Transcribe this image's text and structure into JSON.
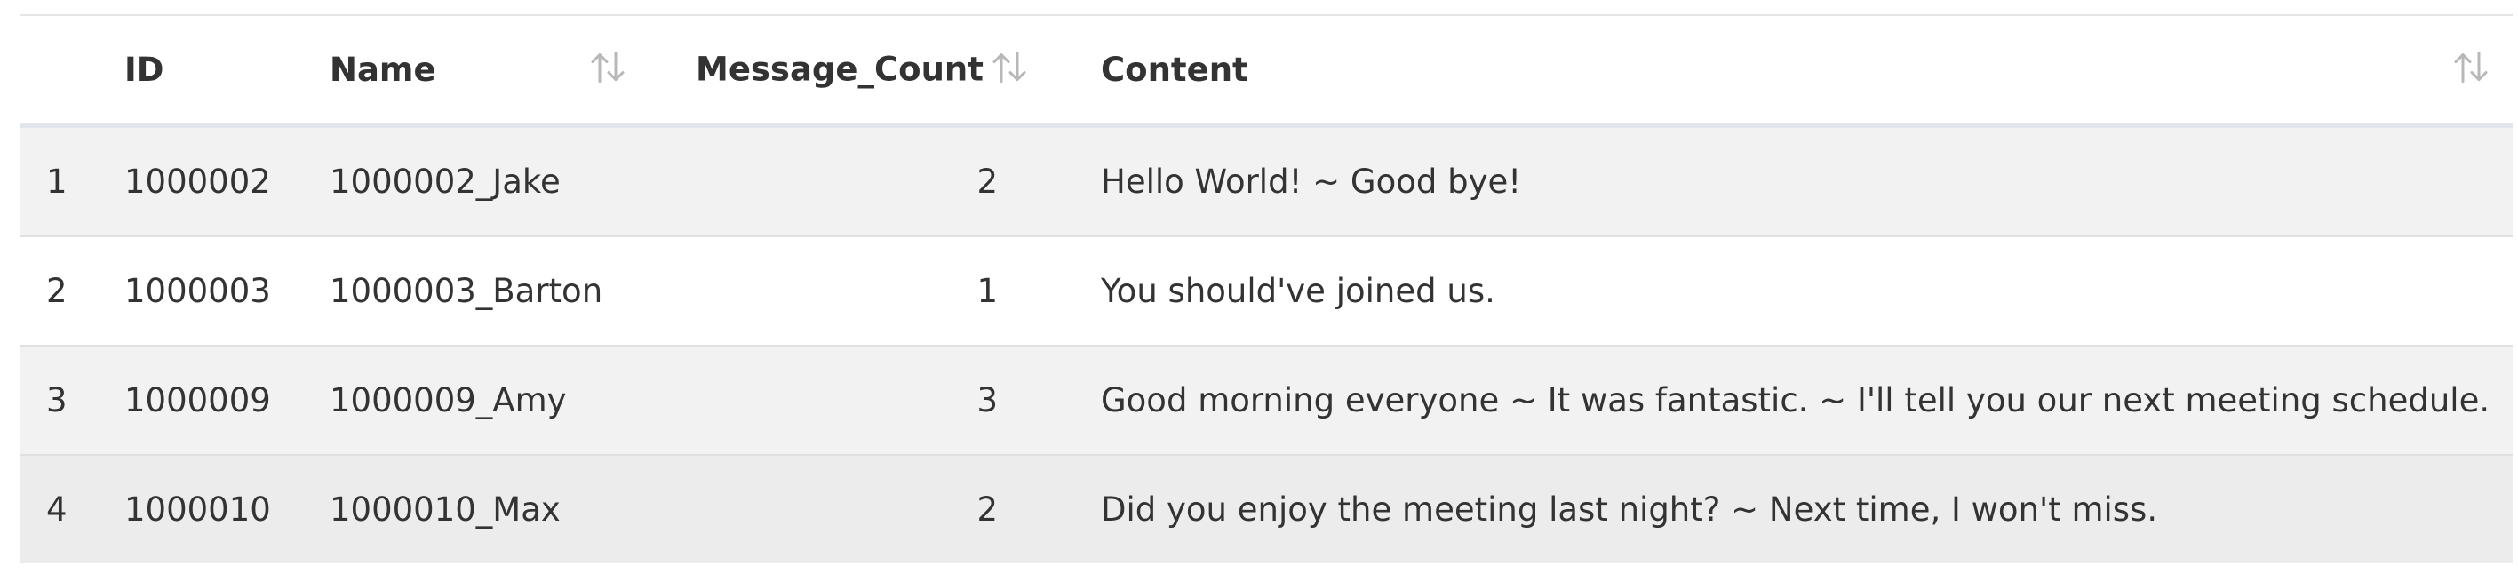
{
  "table": {
    "columns": [
      {
        "key": "index",
        "label": ""
      },
      {
        "key": "id",
        "label": "ID"
      },
      {
        "key": "name",
        "label": "Name"
      },
      {
        "key": "message_count",
        "label": "Message_Count"
      },
      {
        "key": "content",
        "label": "Content"
      }
    ],
    "rows": [
      {
        "index": "1",
        "id": "1000002",
        "name": "1000002_Jake",
        "message_count": "2",
        "content": "Hello World! ~ Good bye!"
      },
      {
        "index": "2",
        "id": "1000003",
        "name": "1000003_Barton",
        "message_count": "1",
        "content": "You should've joined us."
      },
      {
        "index": "3",
        "id": "1000009",
        "name": "1000009_Amy",
        "message_count": "3",
        "content": "Good morning everyone ~ It was fantastic. ~ I'll tell you our next meeting schedule."
      },
      {
        "index": "4",
        "id": "1000010",
        "name": "1000010_Max",
        "message_count": "2",
        "content": "Did you enjoy the meeting last night? ~ Next time, I won't miss."
      }
    ]
  },
  "icons": {
    "sort": "sort-arrows-icon"
  },
  "colors": {
    "header_border": "#e2e6ec",
    "row_odd": "#f2f2f2",
    "row_even": "#ffffff",
    "icon": "#b8b8b8",
    "text": "#333333"
  }
}
